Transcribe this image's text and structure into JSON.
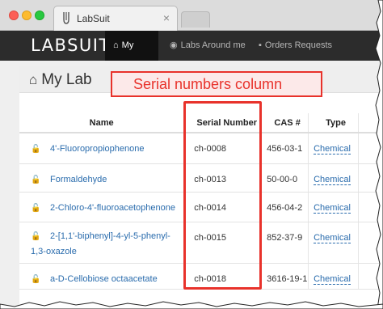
{
  "browser": {
    "tab_title": "LabSuit",
    "tab_close": "×"
  },
  "navbar": {
    "brand": "LABSUIT",
    "items": [
      {
        "label": "My Lab",
        "icon": "home-icon"
      },
      {
        "label": "Labs Around me",
        "icon": "globe-icon"
      },
      {
        "label": "Orders Requests",
        "icon": "truck-icon"
      }
    ]
  },
  "page": {
    "title": "My Lab",
    "title_icon": "home-icon"
  },
  "annotation": {
    "text": "Serial numbers column",
    "color": "#e8322b"
  },
  "table": {
    "headers": {
      "name": "Name",
      "serial": "Serial Number",
      "cas": "CAS #",
      "type": "Type"
    },
    "rows": [
      {
        "name": "4'-Fluoropropiophenone",
        "serial": "ch-0008",
        "cas": "456-03-1",
        "type": "Chemical"
      },
      {
        "name": "Formaldehyde",
        "serial": "ch-0013",
        "cas": "50-00-0",
        "type": "Chemical"
      },
      {
        "name": "2-Chloro-4'-fluoroacetophenone",
        "serial": "ch-0014",
        "cas": "456-04-2",
        "type": "Chemical"
      },
      {
        "name": "2-[1,1'-biphenyl]-4-yl-5-phenyl-1,3-oxazole",
        "serial": "ch-0015",
        "cas": "852-37-9",
        "type": "Chemical"
      },
      {
        "name": "a-D-Cellobiose octaacetate",
        "serial": "ch-0018",
        "cas": "3616-19-1",
        "type": "Chemical"
      }
    ]
  },
  "colors": {
    "navbar_bg": "#2c2c2c",
    "link": "#2a6cad",
    "lock": "#4a9a2e",
    "highlight": "#e8322b"
  }
}
